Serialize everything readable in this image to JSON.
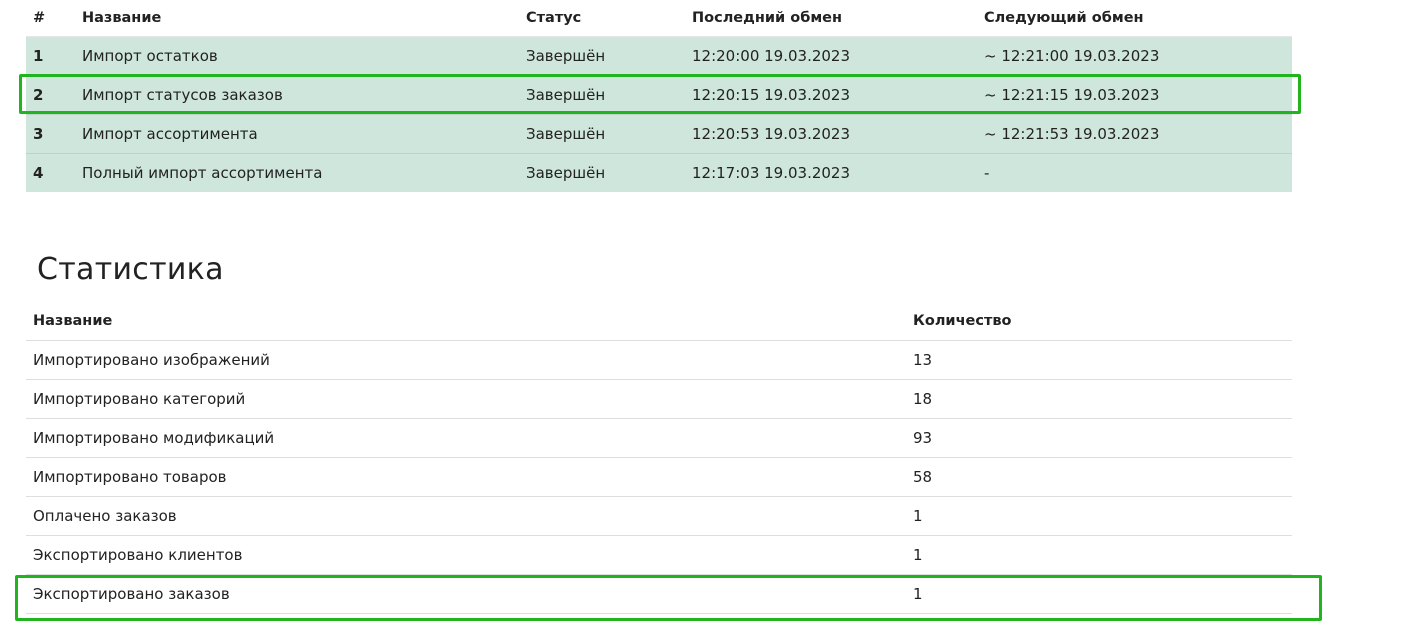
{
  "exchanges": {
    "headers": [
      "#",
      "Название",
      "Статус",
      "Последний обмен",
      "Следующий обмен"
    ],
    "rows": [
      {
        "num": "1",
        "name": "Импорт остатков",
        "status": "Завершён",
        "last": "12:20:00 19.03.2023",
        "next": "~ 12:21:00 19.03.2023"
      },
      {
        "num": "2",
        "name": "Импорт статусов заказов",
        "status": "Завершён",
        "last": "12:20:15 19.03.2023",
        "next": "~ 12:21:15 19.03.2023"
      },
      {
        "num": "3",
        "name": "Импорт ассортимента",
        "status": "Завершён",
        "last": "12:20:53 19.03.2023",
        "next": "~ 12:21:53 19.03.2023"
      },
      {
        "num": "4",
        "name": "Полный импорт ассортимента",
        "status": "Завершён",
        "last": "12:17:03 19.03.2023",
        "next": "-"
      }
    ]
  },
  "statistics": {
    "title": "Статистика",
    "headers": [
      "Название",
      "Количество"
    ],
    "rows": [
      {
        "name": "Импортировано изображений",
        "count": "13"
      },
      {
        "name": "Импортировано категорий",
        "count": "18"
      },
      {
        "name": "Импортировано модификаций",
        "count": "93"
      },
      {
        "name": "Импортировано товаров",
        "count": "58"
      },
      {
        "name": "Оплачено заказов",
        "count": "1"
      },
      {
        "name": "Экспортировано клиентов",
        "count": "1"
      },
      {
        "name": "Экспортировано заказов",
        "count": "1"
      }
    ]
  },
  "colors": {
    "row_background": "#cfe6dd",
    "highlight_border": "#22b41f"
  }
}
